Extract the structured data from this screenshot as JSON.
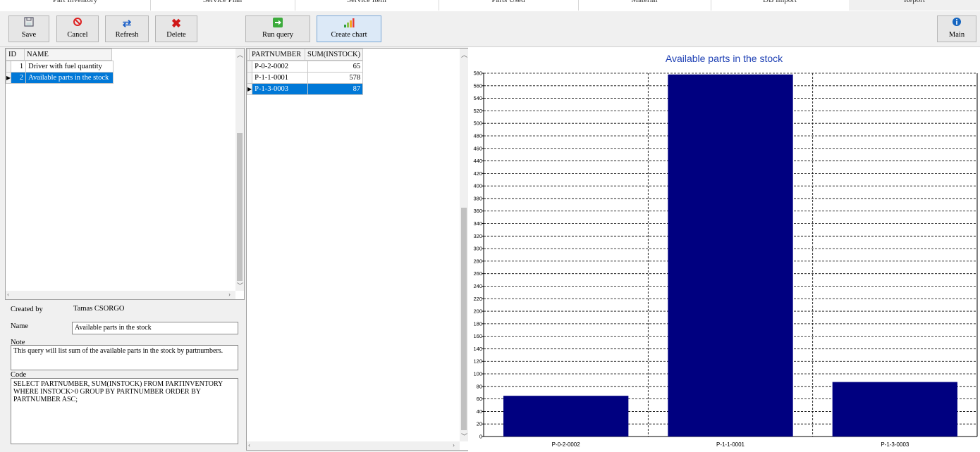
{
  "tabs": [
    {
      "label": "Part Inventory",
      "active": false
    },
    {
      "label": "Service Plan",
      "active": false
    },
    {
      "label": "Service Item",
      "active": false
    },
    {
      "label": "Parts Used",
      "active": false
    },
    {
      "label": "Material",
      "active": false
    },
    {
      "label": "DB Import",
      "active": false
    },
    {
      "label": "Report",
      "active": true
    }
  ],
  "toolbar": {
    "save": {
      "label": "Save",
      "icon": "save-icon"
    },
    "cancel": {
      "label": "Cancel",
      "icon": "cancel-icon"
    },
    "refresh": {
      "label": "Refresh",
      "icon": "refresh-icon"
    },
    "delete": {
      "label": "Delete",
      "icon": "delete-icon"
    },
    "run": {
      "label": "Run query",
      "icon": "run-arrow-icon"
    },
    "chart": {
      "label": "Create chart",
      "icon": "bar-chart-icon"
    },
    "main": {
      "label": "Main",
      "icon": "info-icon"
    }
  },
  "colors": {
    "selection": "#0078d7",
    "bar": "#000080",
    "title": "#1e40b4"
  },
  "queries": {
    "columns": [
      "ID",
      "NAME"
    ],
    "rows": [
      {
        "id": "1",
        "name": "Driver with fuel quantity",
        "selected": false
      },
      {
        "id": "2",
        "name": "Available parts in the stock",
        "selected": true
      }
    ]
  },
  "results": {
    "columns": [
      "PARTNUMBER",
      "SUM(INSTOCK)"
    ],
    "rows": [
      {
        "part": "P-0-2-0002",
        "sum": "65",
        "selected": false
      },
      {
        "part": "P-1-1-0001",
        "sum": "578",
        "selected": false
      },
      {
        "part": "P-1-3-0003",
        "sum": "87",
        "selected": true
      }
    ]
  },
  "form": {
    "created_by_label": "Created by",
    "created_by_value": "Tamas CSORGO",
    "name_label": "Name",
    "name_value": "Available parts in the stock",
    "note_label": "Note",
    "note_value": "This query will list sum of the available parts in the stock by partnumbers.",
    "code_label": "Code",
    "code_value": "SELECT PARTNUMBER, SUM(INSTOCK) FROM PARTINVENTORY WHERE INSTOCK>0 GROUP BY PARTNUMBER ORDER BY PARTNUMBER ASC;"
  },
  "chart_data": {
    "type": "bar",
    "title": "Available parts in the stock",
    "categories": [
      "P-0-2-0002",
      "P-1-1-0001",
      "P-1-3-0003"
    ],
    "values": [
      65,
      578,
      87
    ],
    "ylim": [
      0,
      580
    ],
    "ytick_step": 20,
    "grid": true
  }
}
